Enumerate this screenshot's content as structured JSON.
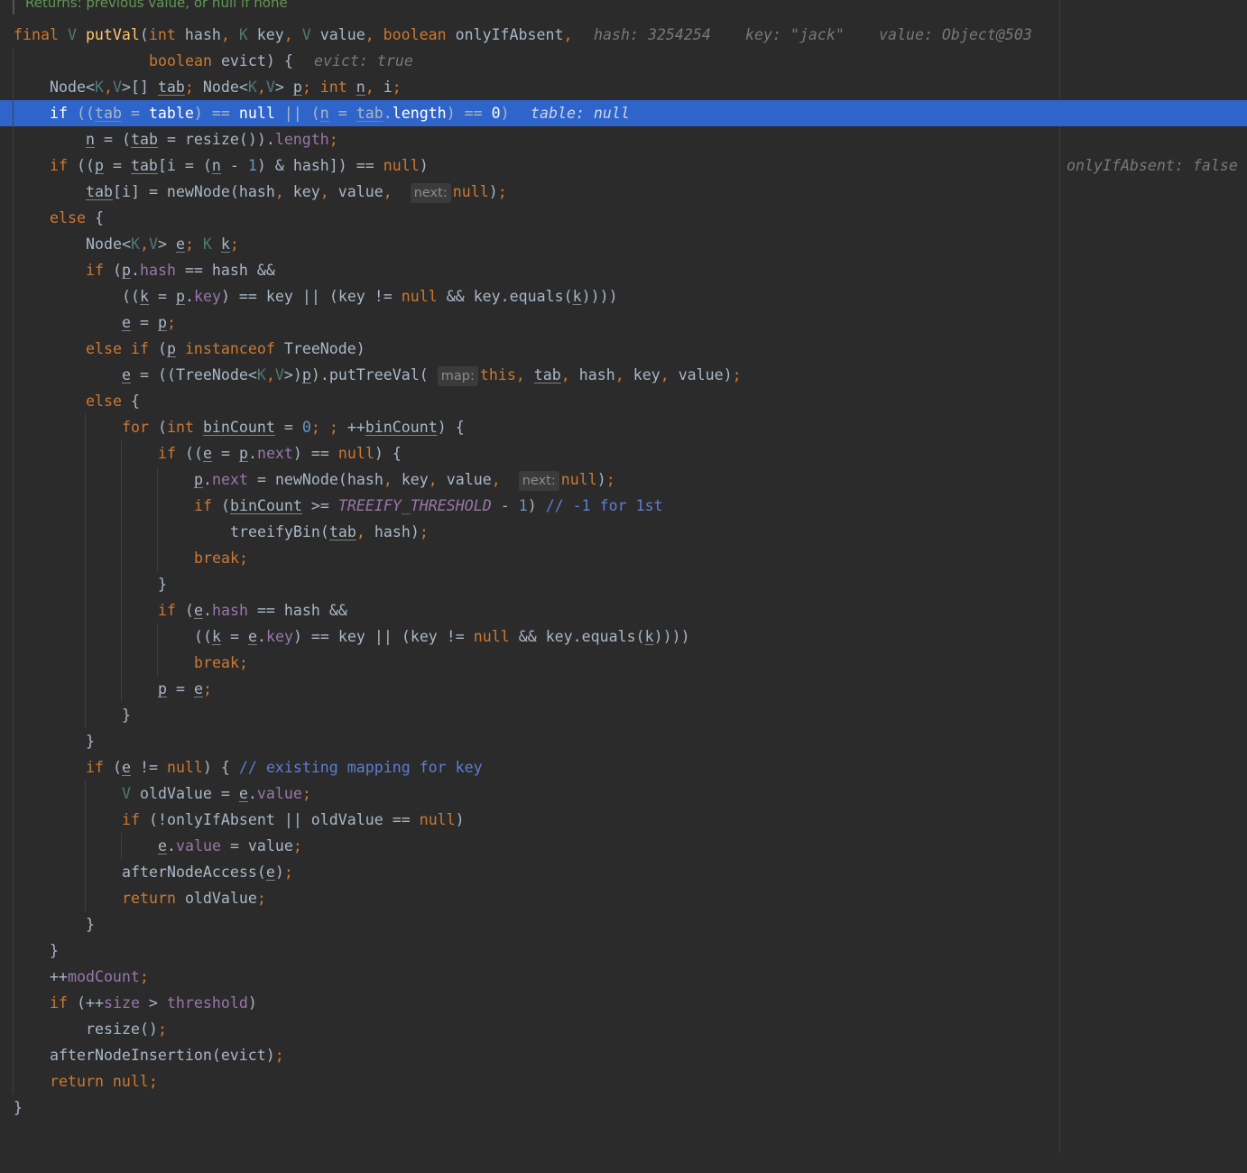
{
  "doc_comment": "Returns: previous value, or null if none",
  "debugger": {
    "hash": "hash: 3254254",
    "key": "key: \"jack\"",
    "value": "value: Object@503",
    "onlyIfAbsent": "onlyIfAbsent: false",
    "evict": "evict: true",
    "table": "table: null"
  },
  "hints": {
    "next": "next:",
    "map": "map:"
  },
  "highlighted_line": 3
}
